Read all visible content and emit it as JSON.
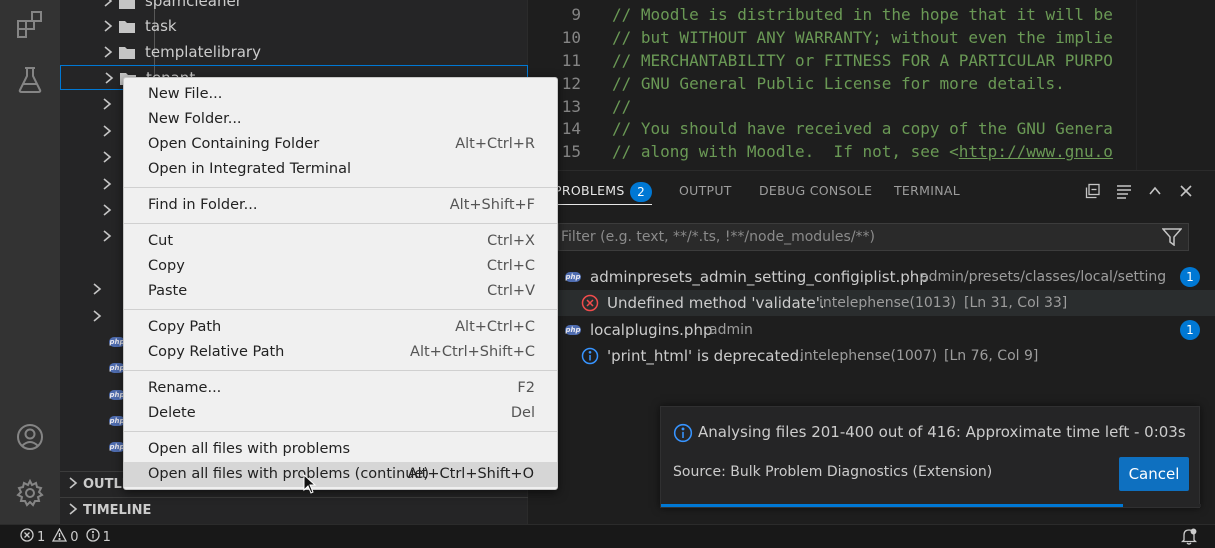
{
  "sidebar": {
    "tree": [
      {
        "label": "spamcleaner",
        "type": "folder"
      },
      {
        "label": "task",
        "type": "folder"
      },
      {
        "label": "templatelibrary",
        "type": "folder"
      },
      {
        "label": "tenant",
        "type": "folder"
      }
    ],
    "sections": {
      "outline": "OUTLINE",
      "timeline": "TIMELINE"
    }
  },
  "editor": {
    "lines": [
      {
        "num": "9",
        "text": "// Moodle is distributed in the hope that it will be"
      },
      {
        "num": "10",
        "text": "// but WITHOUT ANY WARRANTY; without even the implie"
      },
      {
        "num": "11",
        "text": "// MERCHANTABILITY or FITNESS FOR A PARTICULAR PURPO"
      },
      {
        "num": "12",
        "text": "// GNU General Public License for more details."
      },
      {
        "num": "13",
        "text": "//"
      },
      {
        "num": "14",
        "text": "// You should have received a copy of the GNU Genera"
      },
      {
        "num": "15",
        "text": "// along with Moodle.  If not, see <",
        "link": "http://www.gnu.o"
      }
    ]
  },
  "panel": {
    "tabs": {
      "problems": "PROBLEMS",
      "problems_count": "2",
      "output": "OUTPUT",
      "debug_console": "DEBUG CONSOLE",
      "terminal": "TERMINAL"
    },
    "filter_placeholder": "Filter (e.g. text, **/*.ts, !**/node_modules/**)",
    "problems": [
      {
        "file": "adminpresets_admin_setting_configiplist.php",
        "path": "admin/presets/classes/local/setting",
        "count": "1",
        "message": "Undefined method 'validate'.",
        "source": "intelephense(1013)",
        "location": "[Ln 31, Col 33]",
        "severity": "error"
      },
      {
        "file": "localplugins.php",
        "path": "admin",
        "count": "1",
        "message": "'print_html' is deprecated.",
        "source": "intelephense(1007)",
        "location": "[Ln 76, Col 9]",
        "severity": "info"
      }
    ]
  },
  "notification": {
    "message": "Analysing files 201-400 out of 416: Approximate time left - 0:03s",
    "source": "Source: Bulk Problem Diagnostics (Extension)",
    "cancel_label": "Cancel",
    "progress": 0.855
  },
  "context_menu": {
    "groups": [
      [
        {
          "label": "New File...",
          "shortcut": ""
        },
        {
          "label": "New Folder...",
          "shortcut": ""
        },
        {
          "label": "Open Containing Folder",
          "shortcut": "Alt+Ctrl+R"
        },
        {
          "label": "Open in Integrated Terminal",
          "shortcut": ""
        }
      ],
      [
        {
          "label": "Find in Folder...",
          "shortcut": "Alt+Shift+F"
        }
      ],
      [
        {
          "label": "Cut",
          "shortcut": "Ctrl+X"
        },
        {
          "label": "Copy",
          "shortcut": "Ctrl+C"
        },
        {
          "label": "Paste",
          "shortcut": "Ctrl+V"
        }
      ],
      [
        {
          "label": "Copy Path",
          "shortcut": "Alt+Ctrl+C"
        },
        {
          "label": "Copy Relative Path",
          "shortcut": "Alt+Ctrl+Shift+C"
        }
      ],
      [
        {
          "label": "Rename...",
          "shortcut": "F2"
        },
        {
          "label": "Delete",
          "shortcut": "Del"
        }
      ],
      [
        {
          "label": "Open all files with problems",
          "shortcut": ""
        },
        {
          "label": "Open all files with problems (continue)",
          "shortcut": "Alt+Ctrl+Shift+O"
        }
      ]
    ]
  },
  "status_bar": {
    "errors": "1",
    "warnings": "0",
    "infos": "1"
  },
  "colors": {
    "accent": "#0078d4",
    "error": "#f14c4c",
    "info": "#3794ff",
    "comment": "#6a9955"
  }
}
